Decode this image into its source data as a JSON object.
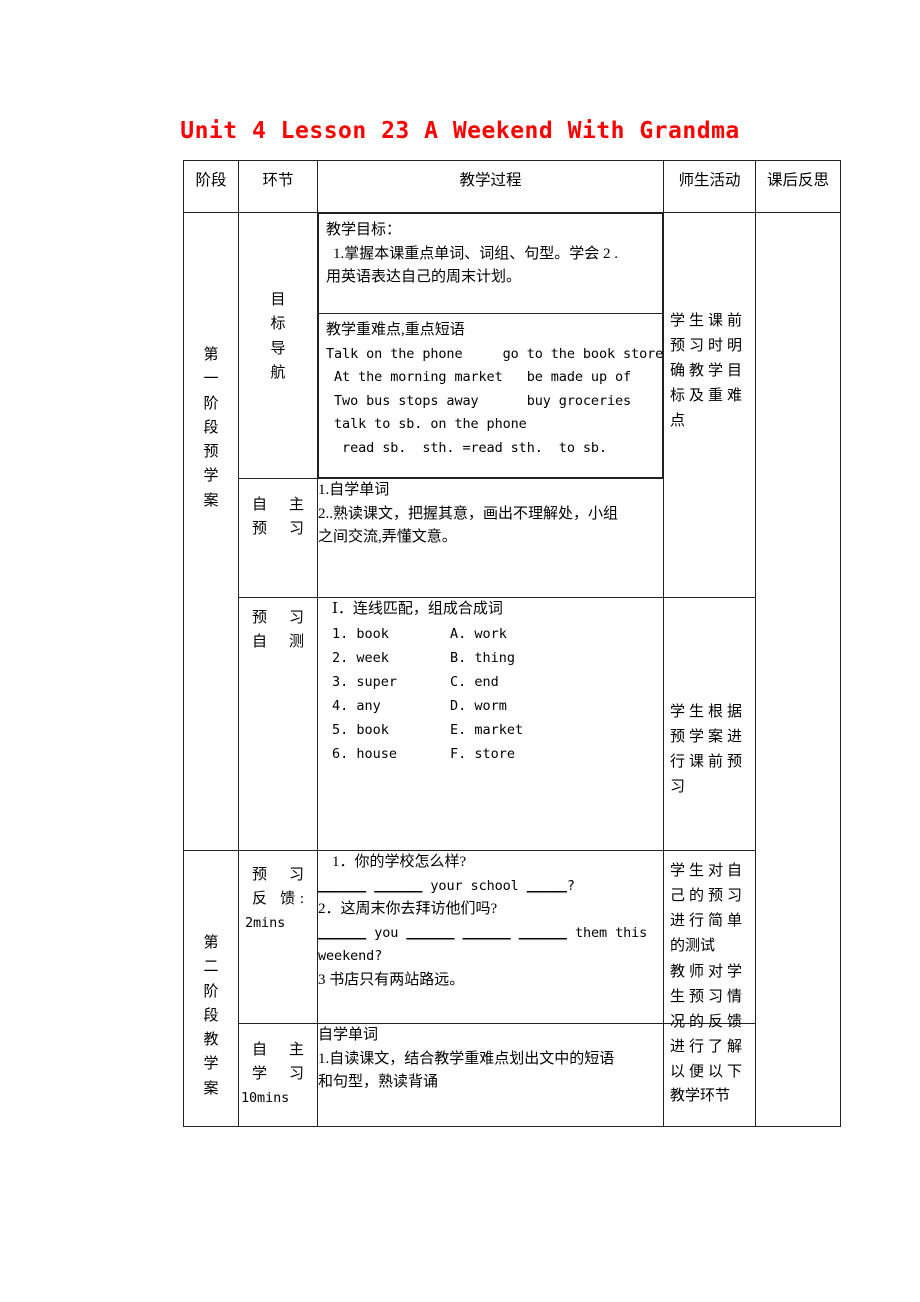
{
  "document": {
    "title": "Unit 4 Lesson 23 A Weekend With Grandma",
    "title_color": "#ff0000"
  },
  "table": {
    "headers": {
      "stage": "阶段",
      "link": "环节",
      "process": "教学过程",
      "activity": "师生活动",
      "reflection": "课后反思"
    },
    "stages": {
      "stage1": [
        "第",
        "一",
        "阶",
        "段",
        "预",
        "学",
        "案"
      ],
      "stage2": [
        "第",
        "二",
        "阶",
        "段",
        "教",
        "学",
        "案"
      ]
    },
    "links": {
      "goal_nav": [
        "目",
        "标",
        "导",
        "航"
      ],
      "self_preview": [
        "自 主",
        "预 习"
      ],
      "preview_test": [
        "预 习",
        "自 测"
      ],
      "preview_feedback": [
        "预 习",
        "反 馈:",
        "2mins"
      ],
      "self_study": [
        "自 主",
        "学 习",
        "10mins"
      ]
    },
    "goal_cell": {
      "heading": "教学目标：",
      "line1": "1.掌握本课重点单词、词组、句型。学会 2 .",
      "line2": "用英语表达自己的周末计划。"
    },
    "key_points_cell": {
      "heading": "教学重难点,重点短语",
      "phrases": [
        "Talk on the phone     go to the book store",
        " At the morning market   be made up of",
        " Two bus stops away      buy groceries",
        " talk to sb. on the phone",
        "  read sb.  sth. =read sth.  to sb."
      ]
    },
    "self_preview_cell": {
      "line1": "1.自学单词",
      "line2": "2..熟读课文，把握其意，画出不理解处，小组",
      "line3": "之间交流,弄懂文意。"
    },
    "preview_test_cell": {
      "heading": "Ⅰ．连线匹配，组成合成词",
      "pairs": [
        {
          "left": "1. book",
          "right": "A. work"
        },
        {
          "left": "2. week",
          "right": "B. thing"
        },
        {
          "left": "3. super",
          "right": "C. end"
        },
        {
          "left": "4. any",
          "right": "D. worm"
        },
        {
          "left": "5. book",
          "right": "E. market"
        },
        {
          "left": "6. house",
          "right": "F. store"
        }
      ]
    },
    "preview_feedback_cell": {
      "q1": "1．你的学校怎么样?",
      "q1_blank_a": "______",
      "q1_blank_b": "______",
      "q1_mid": "your school",
      "q1_blank_c": "_____",
      "q1_end": "?",
      "q2": " 2．这周末你去拜访他们吗?",
      "q2_blank_a": "______",
      "q2_mid1": "you",
      "q2_blank_b": "______",
      "q2_blank_c": "______",
      "q2_blank_d": "______",
      "q2_mid2": "them this",
      "q2_tail": "weekend?",
      "q3": " 3 书店只有两站路远。"
    },
    "self_study_cell": {
      "line1": "自学单词",
      "line2": "1.自读课文，结合教学重难点划出文中的短语",
      "line3": "和句型，熟读背诵"
    },
    "activities": {
      "a1": [
        "学生课前",
        "预习时明",
        "确教学目",
        "标及重难",
        "点"
      ],
      "a2": [
        "学生根据",
        "预学案进",
        "行课前预",
        "习"
      ],
      "a3": [
        "学生对自",
        "己的预习",
        "进行简单",
        "的测试"
      ],
      "a4": [
        "教师对学",
        "生预习情",
        "况的反馈",
        "进行了解",
        "以便以下",
        "教学环节"
      ]
    }
  }
}
